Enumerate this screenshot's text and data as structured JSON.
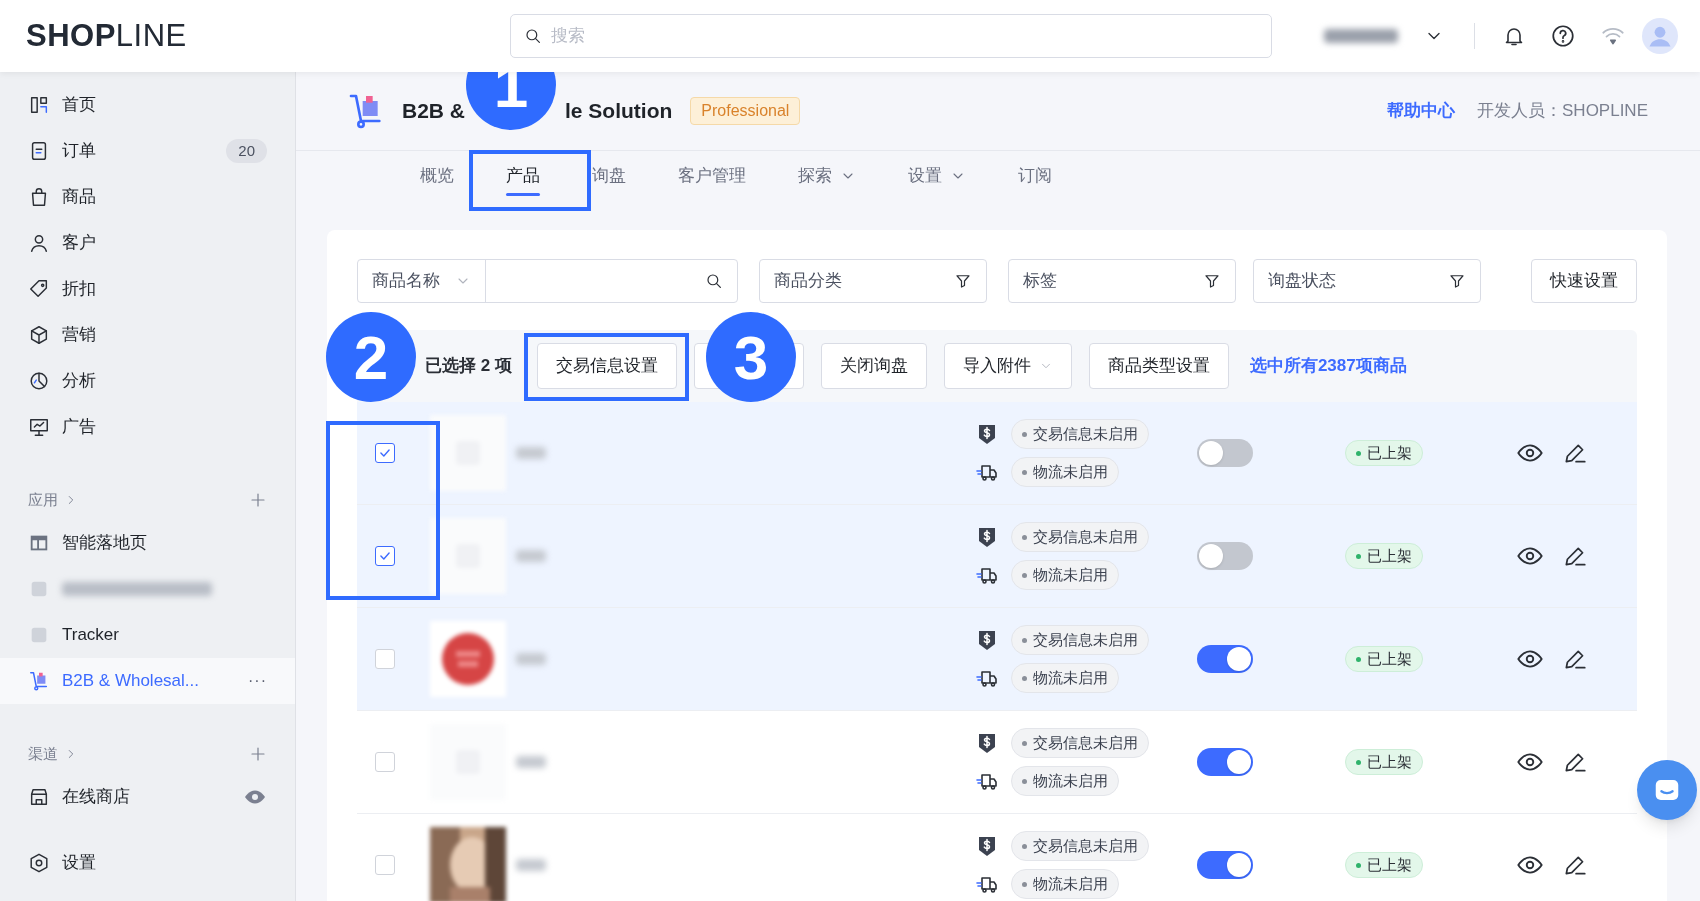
{
  "topbar": {
    "logo": "**SHOP**LINE",
    "search": {
      "placeholder": "搜索"
    }
  },
  "sidebar": {
    "nav": [
      {
        "label": "首页",
        "selected": false
      },
      {
        "label": "订单",
        "badge": "20",
        "selected": false
      },
      {
        "label": "商品",
        "selected": false
      },
      {
        "label": "客户",
        "selected": false
      },
      {
        "label": "折扣",
        "selected": false
      },
      {
        "label": "营销",
        "selected": false
      },
      {
        "label": "分析",
        "selected": false
      },
      {
        "label": "广告",
        "selected": false
      }
    ],
    "sections": [
      {
        "title": "应用",
        "items": [
          {
            "label": "智能落地页",
            "selected": false
          },
          {
            "selected": false
          },
          {
            "label": "Tracker",
            "selected": false
          },
          {
            "label": "B2B & Wholesal...",
            "more": "···",
            "selected": true
          }
        ]
      },
      {
        "title": "渠道",
        "items": [
          {
            "label": "在线商店",
            "eye": true,
            "selected": false
          }
        ]
      }
    ],
    "footer": {
      "label": "设置",
      "selected": false
    }
  },
  "app_header": {
    "title_parts": [
      "B2B &",
      "le Solution"
    ],
    "plan": "Professional",
    "help": "帮助中心",
    "developer": "开发人员：SHOPLINE"
  },
  "tabs": [
    {
      "label": "概览",
      "selected": false
    },
    {
      "label": "产品",
      "selected": true
    },
    {
      "label": "询盘",
      "selected": false
    },
    {
      "label": "客户管理",
      "selected": false
    },
    {
      "label": "探索",
      "dropdown": true,
      "selected": false
    },
    {
      "label": "设置",
      "dropdown": true,
      "selected": false
    },
    {
      "label": "订阅",
      "selected": false
    }
  ],
  "filters": {
    "name_select": "商品名称",
    "category": "商品分类",
    "tags": "标签",
    "inquiry_status": "询盘状态",
    "quick_settings": "快速设置"
  },
  "bulk_bar": {
    "selected_count": "已选择 2 项",
    "buttons": [
      {
        "label": "交易信息设置"
      },
      {
        "covered": true
      },
      {
        "label": "关闭询盘"
      },
      {
        "label": "导入附件",
        "dropdown": true
      },
      {
        "label": "商品类型设置"
      }
    ],
    "select_all": "选中所有2387项商品"
  },
  "products": [
    {
      "checked": true,
      "hovered": false,
      "trade": "交易信息未启用",
      "logistics": "物流未启用",
      "enabled": false,
      "status": "已上架"
    },
    {
      "checked": true,
      "hovered": false,
      "trade": "交易信息未启用",
      "logistics": "物流未启用",
      "enabled": false,
      "status": "已上架"
    },
    {
      "checked": false,
      "hovered": true,
      "trade": "交易信息未启用",
      "logistics": "物流未启用",
      "enabled": true,
      "status": "已上架"
    },
    {
      "checked": false,
      "hovered": false,
      "trade": "交易信息未启用",
      "logistics": "物流未启用",
      "enabled": true,
      "status": "已上架"
    },
    {
      "checked": false,
      "hovered": false,
      "trade": "交易信息未启用",
      "logistics": "物流未启用",
      "enabled": true,
      "status": "已上架"
    }
  ],
  "annotations": [
    {
      "number": "1"
    },
    {
      "number": "2"
    },
    {
      "number": "3"
    }
  ]
}
